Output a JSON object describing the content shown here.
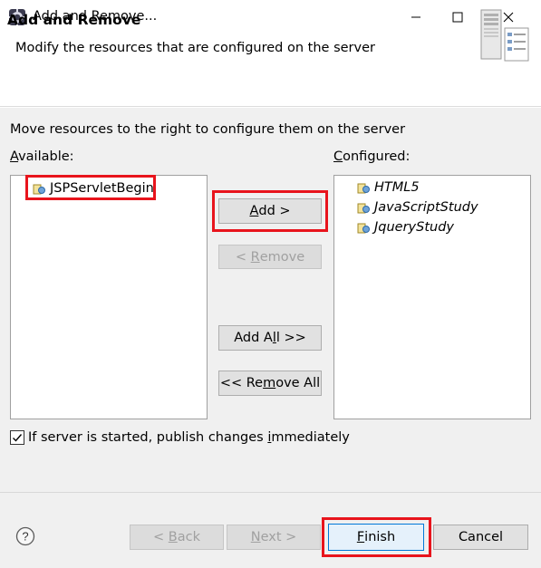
{
  "window": {
    "title": "Add and Remove..."
  },
  "header": {
    "title": "Add and Remove",
    "description": "Modify the resources that are configured on the server"
  },
  "instruction": "Move resources to the right to configure them on the server",
  "available": {
    "label_mnemonic": "A",
    "label_rest": "vailable:",
    "items": [
      "JSPServletBegin"
    ]
  },
  "configured": {
    "label_mnemonic": "C",
    "label_rest": "onfigured:",
    "items": [
      "HTML5",
      "JavaScriptStudy",
      "JqueryStudy"
    ]
  },
  "buttons": {
    "add": {
      "mnemonic": "A",
      "rest": "dd >"
    },
    "remove": {
      "pre": "< ",
      "mnemonic": "R",
      "rest": "emove"
    },
    "add_all": {
      "pre": "Add A",
      "mnemonic": "l",
      "rest": "l >>"
    },
    "remove_all": {
      "pre": "<< Re",
      "mnemonic": "m",
      "rest": "ove All"
    },
    "back": {
      "pre": "< ",
      "mnemonic": "B",
      "rest": "ack"
    },
    "next": {
      "mnemonic": "N",
      "rest": "ext >"
    },
    "finish": {
      "mnemonic": "F",
      "rest": "inish"
    },
    "cancel": "Cancel"
  },
  "publish": {
    "checked": true,
    "pre": "If server is started, publish changes ",
    "mnemonic": "i",
    "rest": "mmediately"
  },
  "colors": {
    "highlight": "#e8141c",
    "focus": "#0078d7"
  }
}
